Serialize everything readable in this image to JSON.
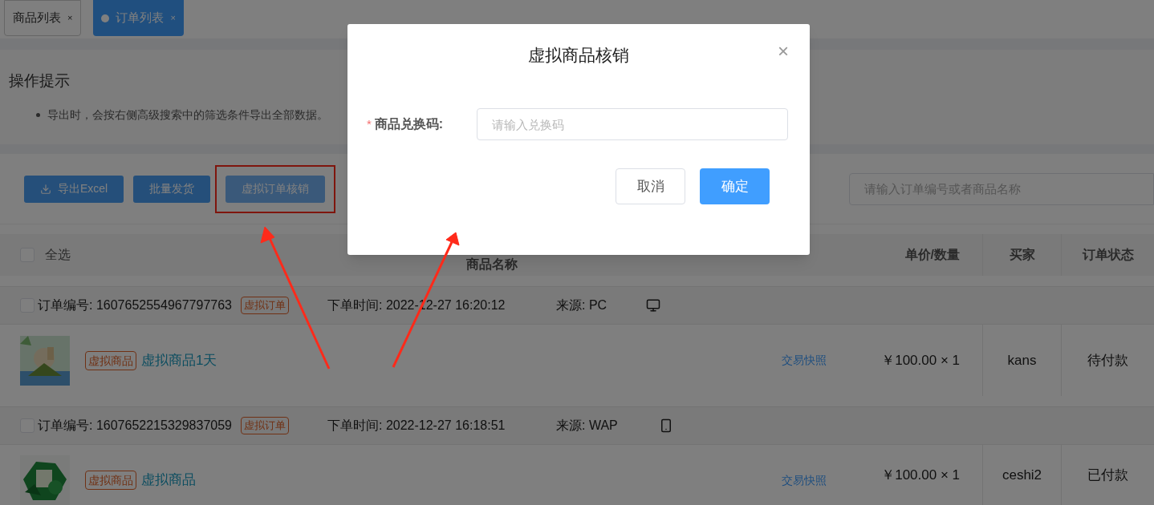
{
  "tabs": [
    {
      "label": "商品列表",
      "close": "×",
      "selected": false
    },
    {
      "label": "订单列表",
      "close": "×",
      "selected": true
    }
  ],
  "tips": {
    "title": "操作提示",
    "items": [
      "导出时，会按右侧高级搜索中的筛选条件导出全部数据。"
    ]
  },
  "toolbar": {
    "buttons": [
      {
        "label": "导出Excel",
        "kind": "download",
        "highlighted": false
      },
      {
        "label": "批量发货",
        "kind": "plain",
        "highlighted": false
      },
      {
        "label": "虚拟订单核销",
        "kind": "plain",
        "highlighted": true
      }
    ],
    "search": {
      "placeholder": "请输入订单编号或者商品名称"
    }
  },
  "table": {
    "select_all": {
      "label": "全选",
      "checked": false
    },
    "columns": [
      "商品名称",
      "单价/数量",
      "买家",
      "订单状态"
    ],
    "orders": [
      {
        "checked": false,
        "number_label": "订单编号:",
        "number": "1607652554967797763",
        "tag": "虚拟订单",
        "time": "下单时间: 2022-12-27 16:20:12",
        "source": "来源: PC",
        "kind": "desktop",
        "product_tag": "虚拟商品",
        "product": "虚拟商品1天",
        "snapshot": "交易快照",
        "price": "￥100.00 × 1",
        "buyer": "kans",
        "status": "待付款"
      },
      {
        "checked": false,
        "number_label": "订单编号:",
        "number": "1607652215329837059",
        "tag": "虚拟订单",
        "time": "下单时间: 2022-12-27 16:18:51",
        "source": "来源: WAP",
        "kind": "mobile",
        "product_tag": "虚拟商品",
        "product": "虚拟商品",
        "snapshot": "交易快照",
        "price": "￥100.00 × 1",
        "buyer": "ceshi2",
        "status": "已付款"
      }
    ]
  },
  "dialog": {
    "title": "虚拟商品核销",
    "close": "×",
    "field": {
      "required_mark": "*",
      "label": "商品兑换码:",
      "placeholder": "请输入兑换码"
    },
    "buttons": [
      {
        "label": "取消",
        "primary": false
      },
      {
        "label": "确定",
        "primary": true
      }
    ]
  }
}
